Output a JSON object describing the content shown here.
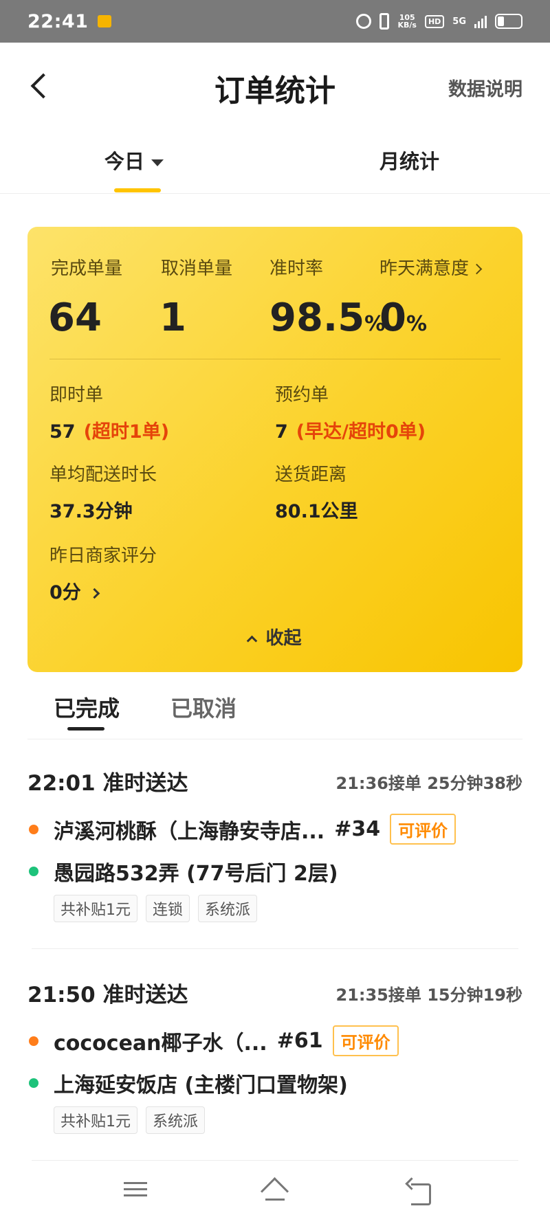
{
  "status_bar": {
    "time": "22:41",
    "net_speed_value": "105",
    "net_speed_unit": "KB/s",
    "hd": "HD",
    "network": "5G"
  },
  "header": {
    "title": "订单统计",
    "help_label": "数据说明"
  },
  "period_tabs": {
    "today": "今日",
    "month": "月统计"
  },
  "summary": {
    "completed_label": "完成单量",
    "completed_value": "64",
    "cancelled_label": "取消单量",
    "cancelled_value": "1",
    "ontime_label": "准时率",
    "ontime_value": "98.5",
    "ontime_unit": "%",
    "satisfaction_label": "昨天满意度",
    "satisfaction_value": "0",
    "satisfaction_unit": "%"
  },
  "details": {
    "instant_label": "即时单",
    "instant_value": "57",
    "instant_note": "(超时1单)",
    "reserved_label": "预约单",
    "reserved_value": "7",
    "reserved_note": "(早达/超时0单)",
    "avg_time_label": "单均配送时长",
    "avg_time_value": "37.3分钟",
    "distance_label": "送货距离",
    "distance_value": "80.1公里",
    "merchant_score_label": "昨日商家评分",
    "merchant_score_value": "0分",
    "collapse_label": "收起"
  },
  "order_tabs": {
    "completed": "已完成",
    "cancelled": "已取消"
  },
  "orders": [
    {
      "time": "22:01",
      "status": "准时送达",
      "meta": "21:36接单 25分钟38秒",
      "shop": "泸溪河桃酥（上海静安寺店...",
      "order_no": "#34",
      "rate_label": "可评价",
      "address": "愚园路532弄 (77号后门 2层)",
      "tags": [
        "共补贴1元",
        "连锁",
        "系统派"
      ]
    },
    {
      "time": "21:50",
      "status": "准时送达",
      "meta": "21:35接单 15分钟19秒",
      "shop": "cococean椰子水（...",
      "order_no": "#61",
      "rate_label": "可评价",
      "address": "上海延安饭店 (主楼门口置物架)",
      "tags": [
        "共补贴1元",
        "系统派"
      ]
    }
  ],
  "colors": {
    "card_yellow": "#fbd22a",
    "accent_red": "#e5440a",
    "rate_orange": "#ff8a00",
    "dot_orange": "#ff7d1a",
    "dot_green": "#1dc27a"
  },
  "icons": {
    "back": "chevron-left-icon",
    "dropdown": "caret-down-icon",
    "menu": "menu-icon",
    "home": "home-icon",
    "return": "return-icon"
  }
}
